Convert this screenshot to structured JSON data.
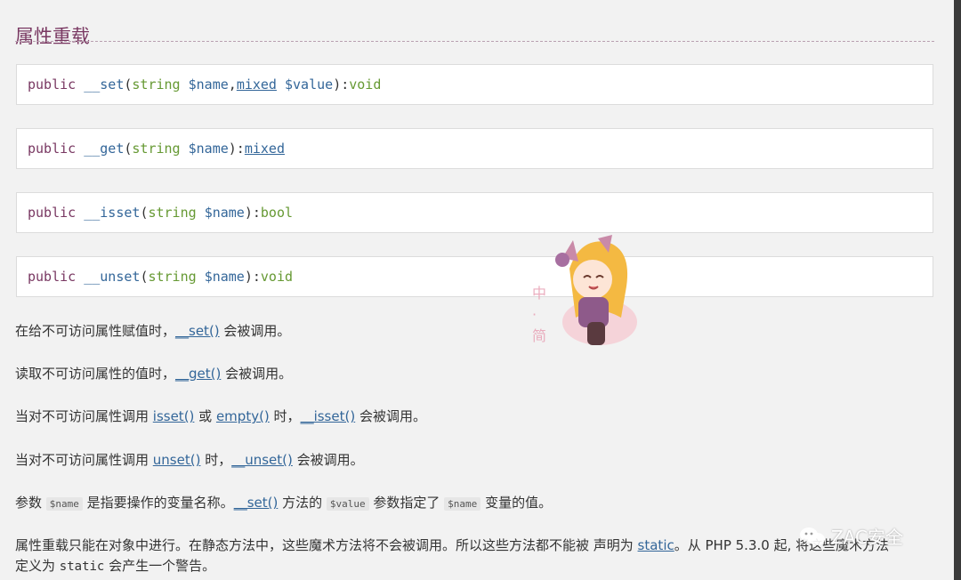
{
  "section": {
    "title": "属性重载"
  },
  "signatures": [
    {
      "vis": "public",
      "name": "__set",
      "open": "(",
      "p1_type": "string",
      "p1_var": "$name",
      "sep": ", ",
      "p2_type": "mixed",
      "p2_var": "$value",
      "close": "): ",
      "ret": "void"
    },
    {
      "vis": "public",
      "name": "__get",
      "open": "(",
      "p1_type": "string",
      "p1_var": "$name",
      "close": "): ",
      "ret": "mixed"
    },
    {
      "vis": "public",
      "name": "__isset",
      "open": "(",
      "p1_type": "string",
      "p1_var": "$name",
      "close": "): ",
      "ret": "bool"
    },
    {
      "vis": "public",
      "name": "__unset",
      "open": "(",
      "p1_type": "string",
      "p1_var": "$name",
      "close": "): ",
      "ret": "void"
    }
  ],
  "paragraphs": {
    "p1": {
      "pre": "在给不可访问属性赋值时，",
      "link": "__set()",
      "post": " 会被调用。"
    },
    "p2": {
      "pre": "读取不可访问属性的值时，",
      "link": "__get()",
      "post": " 会被调用。"
    },
    "p3": {
      "pre": "当对不可访问属性调用 ",
      "link1": "isset()",
      "mid1": " 或 ",
      "link2": "empty()",
      "mid2": " 时，",
      "link3": "__isset()",
      "post": " 会被调用。"
    },
    "p4": {
      "pre": "当对不可访问属性调用 ",
      "link1": "unset()",
      "mid1": " 时，",
      "link2": "__unset()",
      "post": " 会被调用。"
    },
    "p5": {
      "pre": "参数 ",
      "code1": "$name",
      "mid1": " 是指要操作的变量名称。",
      "link1": "__set()",
      "mid2": " 方法的 ",
      "code2": "$value",
      "mid3": " 参数指定了 ",
      "code3": "$name",
      "post": " 变量的值。"
    },
    "p6": {
      "pre": "属性重载只能在对象中进行。在静态方法中，这些魔术方法将不会被调用。所以这些方法都不能被 声明为 ",
      "link": "static",
      "mid": "。从 PHP 5.3.0 起, 将这些魔术方法",
      "line2_pre": "定义为 ",
      "code": "static",
      "post": " 会产生一个警告。"
    }
  },
  "mascot": {
    "label": "中·简"
  },
  "watermark": {
    "text": "ZAC安全"
  },
  "colors": {
    "title": "#793862",
    "keyword": "#793862",
    "type": "#669933",
    "link": "#336699",
    "background": "#f2f2f2"
  }
}
